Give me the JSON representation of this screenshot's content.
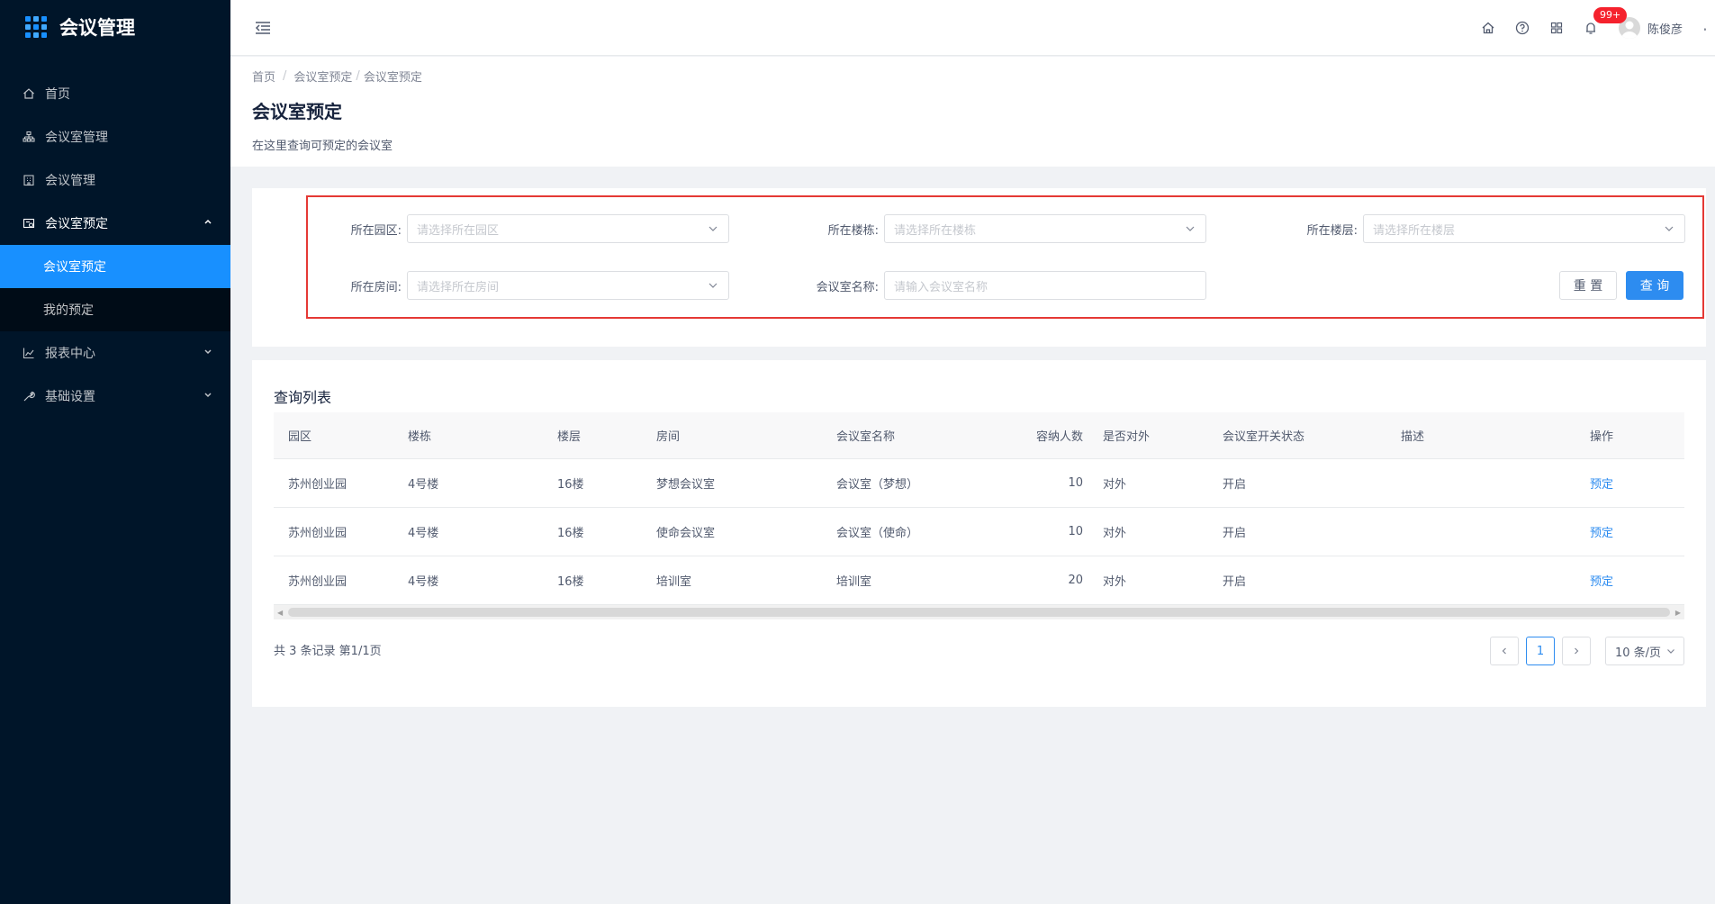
{
  "app": {
    "title": "会议管理"
  },
  "sidebar": {
    "items": [
      {
        "label": "首页",
        "icon": "home-icon"
      },
      {
        "label": "会议室管理",
        "icon": "org-icon"
      },
      {
        "label": "会议管理",
        "icon": "building-icon"
      },
      {
        "label": "会议室预定",
        "icon": "booking-icon"
      },
      {
        "label": "报表中心",
        "icon": "chart-icon"
      },
      {
        "label": "基础设置",
        "icon": "wrench-icon"
      }
    ],
    "submenu": [
      {
        "label": "会议室预定"
      },
      {
        "label": "我的预定"
      }
    ]
  },
  "header": {
    "badge": "99+",
    "username": "陈俊彦"
  },
  "breadcrumb": {
    "home": "首页",
    "parent": "会议室预定",
    "current": "会议室预定",
    "separator": "/"
  },
  "page": {
    "title": "会议室预定",
    "description": "在这里查询可预定的会议室"
  },
  "search": {
    "park_label": "所在园区:",
    "park_placeholder": "请选择所在园区",
    "building_label": "所在楼栋:",
    "building_placeholder": "请选择所在楼栋",
    "floor_label": "所在楼层:",
    "floor_placeholder": "请选择所在楼层",
    "room_label": "所在房间:",
    "room_placeholder": "请选择所在房间",
    "name_label": "会议室名称:",
    "name_placeholder": "请输入会议室名称",
    "reset": "重 置",
    "query": "查 询"
  },
  "table": {
    "title": "查询列表",
    "columns": [
      "园区",
      "楼栋",
      "楼层",
      "房间",
      "会议室名称",
      "容纳人数",
      "是否对外",
      "会议室开关状态",
      "描述",
      "操作"
    ],
    "rows": [
      [
        "苏州创业园",
        "4号楼",
        "16楼",
        "梦想会议室",
        "会议室（梦想）",
        "10",
        "对外",
        "开启",
        "",
        "预定"
      ],
      [
        "苏州创业园",
        "4号楼",
        "16楼",
        "使命会议室",
        "会议室（使命）",
        "10",
        "对外",
        "开启",
        "",
        "预定"
      ],
      [
        "苏州创业园",
        "4号楼",
        "16楼",
        "培训室",
        "培训室",
        "20",
        "对外",
        "开启",
        "",
        "预定"
      ]
    ]
  },
  "pagination": {
    "summary": "共 3 条记录 第1/1页",
    "current": "1",
    "page_size": "10 条/页"
  }
}
